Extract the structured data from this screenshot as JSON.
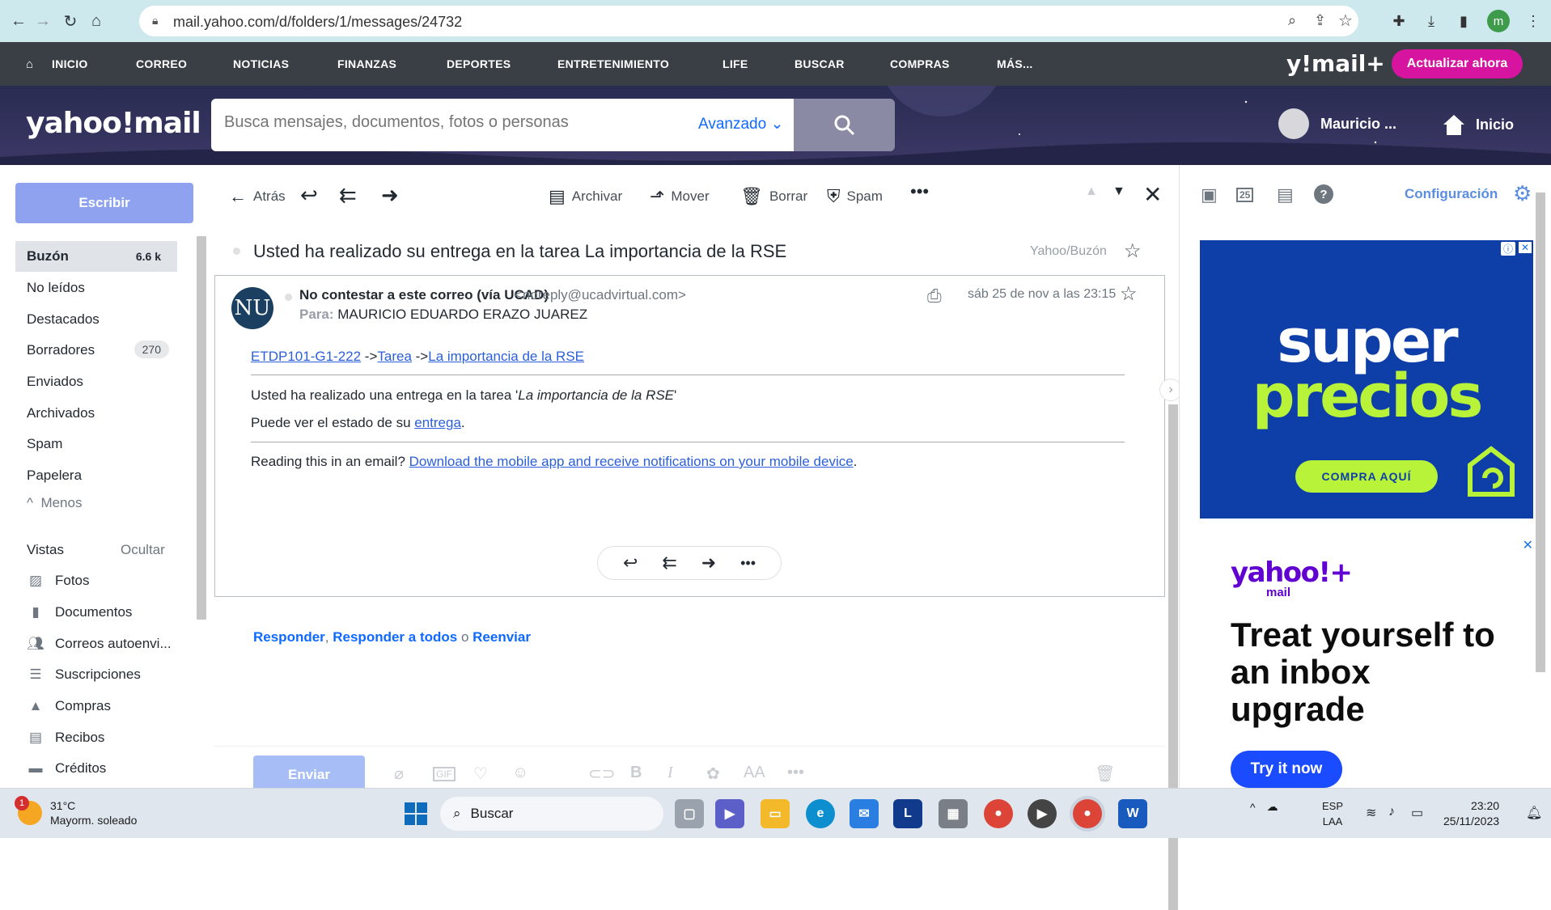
{
  "browser": {
    "url": "mail.yahoo.com/d/folders/1/messages/24732",
    "profile_initial": "m"
  },
  "yahoo_nav": {
    "items": [
      "INICIO",
      "CORREO",
      "NOTICIAS",
      "FINANZAS",
      "DEPORTES",
      "ENTRETENIMIENTO",
      "LIFE",
      "BUSCAR",
      "COMPRAS",
      "MÁS..."
    ],
    "brand": "y!mail+",
    "upgrade_label": "Actualizar ahora"
  },
  "header": {
    "logo": "yahoo!mail",
    "search_placeholder": "Busca mensajes, documentos, fotos o personas",
    "advanced_label": "Avanzado",
    "user_name": "Mauricio ...",
    "home_label": "Inicio"
  },
  "sidebar": {
    "compose_label": "Escribir",
    "folders": [
      {
        "label": "Buzón",
        "count": "6.6 k"
      },
      {
        "label": "No leídos"
      },
      {
        "label": "Destacados"
      },
      {
        "label": "Borradores",
        "count": "270"
      },
      {
        "label": "Enviados"
      },
      {
        "label": "Archivados"
      },
      {
        "label": "Spam"
      },
      {
        "label": "Papelera"
      }
    ],
    "less_label": "Menos",
    "views_label": "Vistas",
    "hide_label": "Ocultar",
    "views": [
      {
        "label": "Fotos",
        "icon": "photo-icon"
      },
      {
        "label": "Documentos",
        "icon": "document-icon"
      },
      {
        "label": "Correos autoenvi...",
        "icon": "people-icon"
      },
      {
        "label": "Suscripciones",
        "icon": "subscriptions-icon"
      },
      {
        "label": "Compras",
        "icon": "shopping-bag-icon"
      },
      {
        "label": "Recibos",
        "icon": "receipt-icon"
      },
      {
        "label": "Créditos",
        "icon": "card-icon"
      }
    ]
  },
  "toolbar": {
    "back_label": "Atrás",
    "archive_label": "Archivar",
    "move_label": "Mover",
    "delete_label": "Borrar",
    "spam_label": "Spam"
  },
  "message": {
    "subject": "Usted ha realizado su entrega en la tarea La importancia de la RSE",
    "folder": "Yahoo/Buzón",
    "avatar_initials": "NU",
    "sender_name": "No contestar a este correo (vía UCAD)",
    "sender_email": "<noreply@ucadvirtual.com>",
    "to_label": "Para:",
    "to_value": "MAURICIO EDUARDO ERAZO JUAREZ",
    "date": "sáb 25 de nov a las 23:15",
    "breadcrumb_course": "ETDP101-G1-222",
    "breadcrumb_sep": " ->",
    "breadcrumb_task": "Tarea",
    "breadcrumb_title": "La importancia de la RSE",
    "line1_prefix": "Usted ha realizado una entrega en la tarea '",
    "line1_italic": "La importancia de la RSE",
    "line1_suffix": "'",
    "line2_prefix": "Puede ver el estado de su ",
    "line2_link": "entrega",
    "line2_suffix": ".",
    "line3_prefix": "Reading this in an email? ",
    "line3_link": "Download the mobile app and receive notifications on your mobile device",
    "line3_suffix": "."
  },
  "reply": {
    "reply_label": "Responder",
    "reply_all_label": "Responder a todos",
    "or_label": "o",
    "forward_label": "Reenviar",
    "send_label": "Enviar"
  },
  "right_panel": {
    "config_label": "Configuración",
    "calendar_day": "25",
    "ad1_line1": "super",
    "ad1_line2": "precios",
    "ad1_cta": "COMPRA AQUÍ",
    "ad2_brand": "yahoo!+",
    "ad2_brand_sub": "mail",
    "ad2_headline": "Treat yourself to an inbox upgrade",
    "ad2_cta": "Try it now"
  },
  "taskbar": {
    "weather_temp": "31°C",
    "weather_desc": "Mayorm. soleado",
    "weather_badge": "1",
    "search_label": "Buscar",
    "lang_line1": "ESP",
    "lang_line2": "LAA",
    "time": "23:20",
    "date": "25/11/2023"
  }
}
